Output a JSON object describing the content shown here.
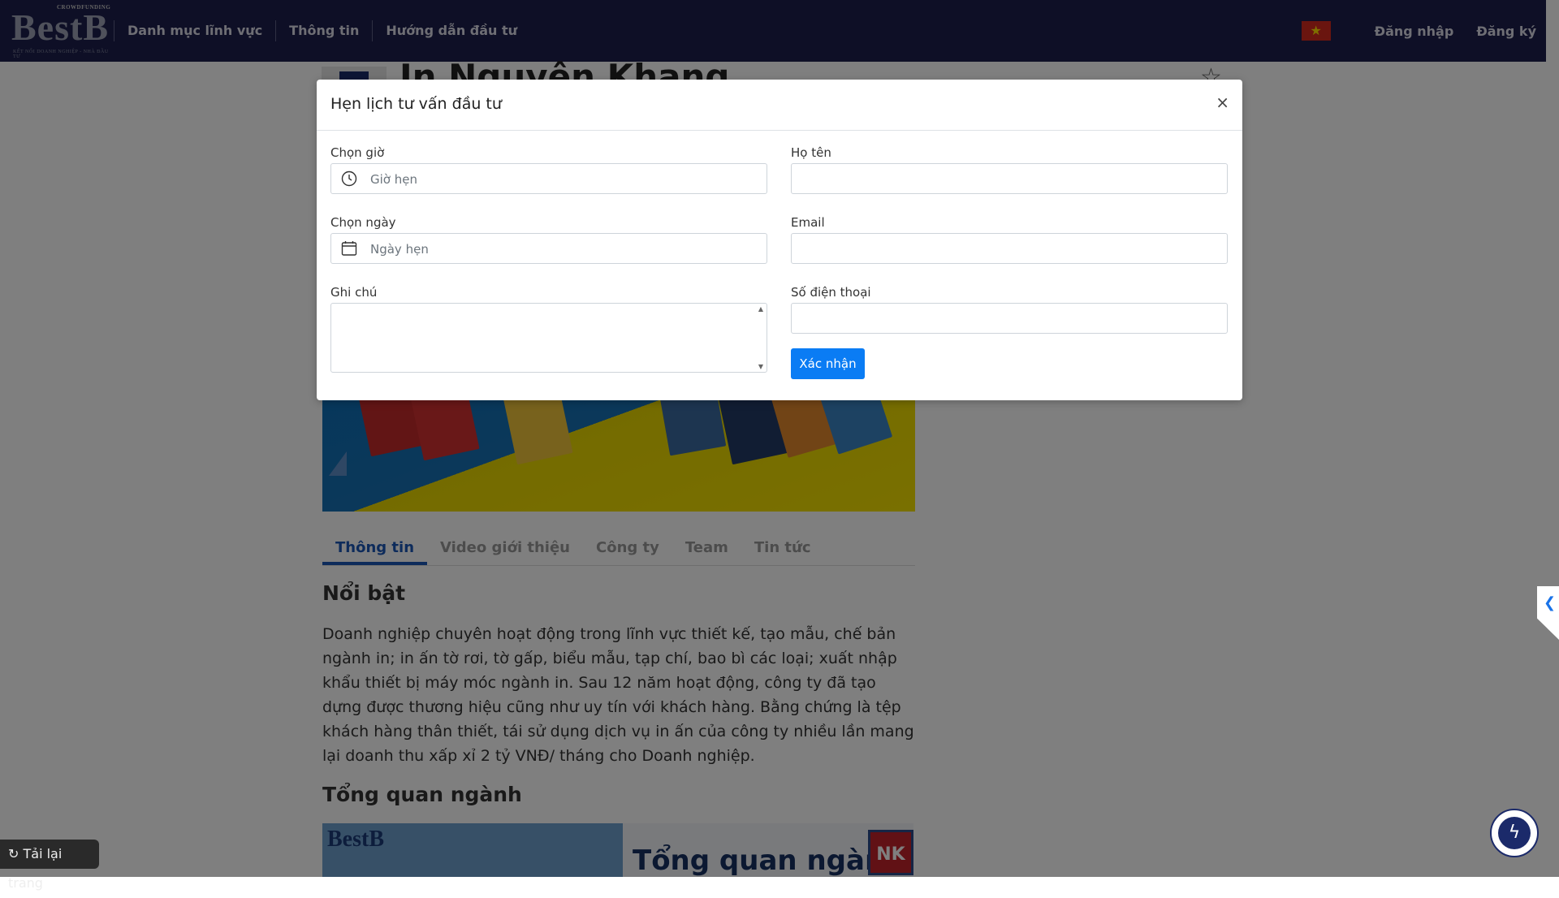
{
  "navbar": {
    "logo_small": "CROWDFUNDING",
    "logo_text": "BestB",
    "logo_sub": "KẾT NỐI DOANH NGHIỆP - NHÀ ĐẦU TƯ",
    "menu": [
      "Danh mục lĩnh vực",
      "Thông tin",
      "Hướng dẫn đầu tư"
    ],
    "login": "Đăng nhập",
    "register": "Đăng ký",
    "flag_star": "★"
  },
  "page": {
    "company_title": "In Nguyên Khang",
    "tabs": [
      "Thông tin",
      "Video giới thiệu",
      "Công ty",
      "Team",
      "Tin tức"
    ],
    "active_tab": "Thông tin",
    "section_highlight": "Nổi bật",
    "paragraph": "Doanh nghiệp chuyên hoạt động trong lĩnh vực thiết kế, tạo mẫu, chế bản ngành in; in ấn tờ rơi, tờ gấp, biểu mẫu, tạp chí, bao bì các loại; xuất nhập khẩu thiết bị máy móc ngành in. Sau 12 năm hoạt động, công ty đã tạo dựng được thương hiệu cũng như uy tín với khách hàng. Bằng chứng là tệp khách hàng thân thiết, tái sử dụng dịch vụ in ấn của công ty nhiều lần mang lại doanh thu xấp xỉ 2 tỷ VNĐ/ tháng cho Doanh nghiệp.",
    "section_industry": "Tổng quan ngành",
    "industry_logo": "BestB",
    "industry_image_title": "Tổng quan ngành",
    "industry_badge": "NK",
    "reload": "Tải lại trang"
  },
  "modal": {
    "title": "Hẹn lịch tư vấn đầu tư",
    "close": "×",
    "time_label": "Chọn giờ",
    "time_placeholder": "Giờ hẹn",
    "date_label": "Chọn ngày",
    "date_placeholder": "Ngày hẹn",
    "note_label": "Ghi chú",
    "name_label": "Họ tên",
    "email_label": "Email",
    "phone_label": "Số điện thoại",
    "confirm": "Xác nhận"
  },
  "colors": {
    "navbar_bg": "#1d1f4c",
    "primary": "#0a7cf4",
    "tab_active": "#1a56b7"
  }
}
